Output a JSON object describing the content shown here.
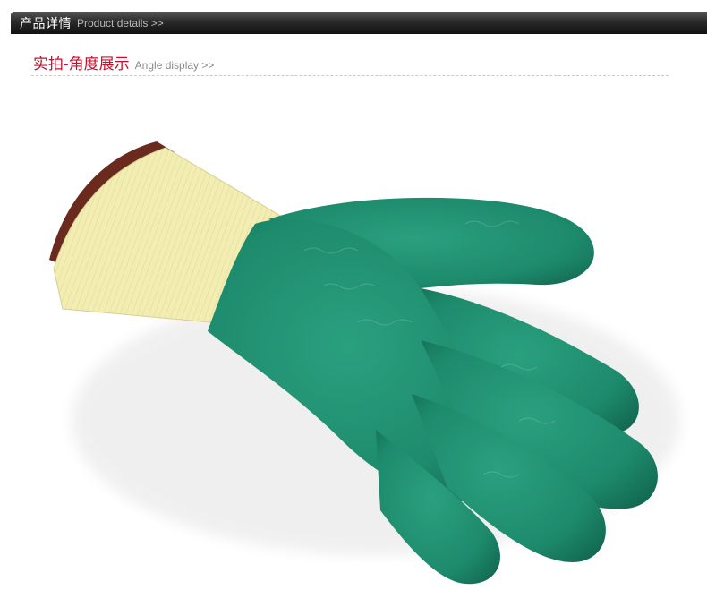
{
  "header": {
    "title_cn": "产品详情",
    "title_en": "Product details >>"
  },
  "section": {
    "title_cn": "实拍-角度展示",
    "title_en": "Angle display >>"
  },
  "image": {
    "subject": "glove-photo",
    "colors": {
      "cuff": "#f4efb4",
      "palm": "#1f8a6e",
      "cuff_trim": "#6b2a1e",
      "accent": "#c8102e"
    }
  }
}
